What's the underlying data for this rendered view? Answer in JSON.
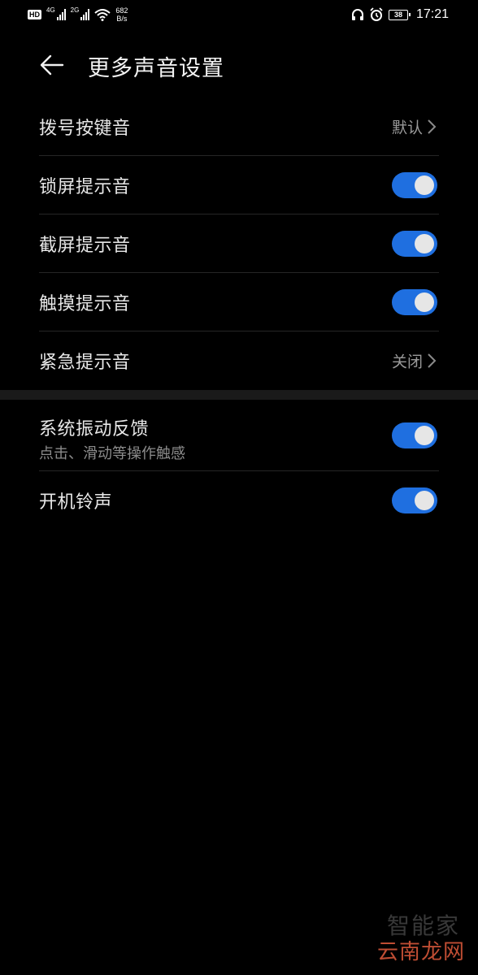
{
  "status_bar": {
    "hd": "HD",
    "net1": "4G",
    "net2": "2G",
    "speed_value": "682",
    "speed_unit": "B/s",
    "battery": "38",
    "time": "17:21"
  },
  "header": {
    "title": "更多声音设置"
  },
  "group1": [
    {
      "label": "拨号按键音",
      "value": "默认"
    },
    {
      "label": "锁屏提示音",
      "toggle": true
    },
    {
      "label": "截屏提示音",
      "toggle": true
    },
    {
      "label": "触摸提示音",
      "toggle": true
    },
    {
      "label": "紧急提示音",
      "value": "关闭"
    }
  ],
  "group2": [
    {
      "label": "系统振动反馈",
      "sublabel": "点击、滑动等操作触感",
      "toggle": true
    },
    {
      "label": "开机铃声",
      "toggle": true
    }
  ],
  "watermark": {
    "top": "智能家",
    "bottom": "云南龙网"
  },
  "colors": {
    "background": "#000000",
    "toggle_on": "#1f6fe0",
    "divider": "#1a1a1a"
  }
}
